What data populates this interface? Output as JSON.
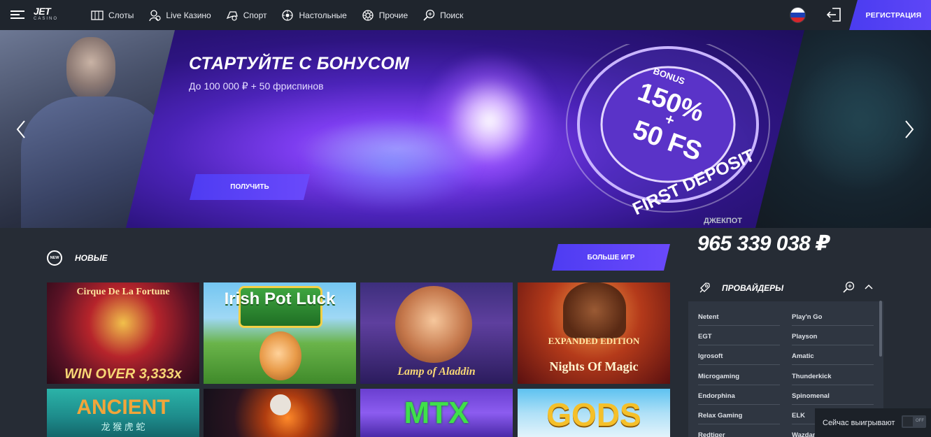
{
  "header": {
    "logo_main": "JET",
    "logo_sub": "CASINO",
    "nav": [
      {
        "label": "Слоты",
        "icon": "slots-icon"
      },
      {
        "label": "Live Казино",
        "icon": "live-casino-icon"
      },
      {
        "label": "Спорт",
        "icon": "sport-icon"
      },
      {
        "label": "Настольные",
        "icon": "table-games-icon"
      },
      {
        "label": "Прочие",
        "icon": "other-games-icon"
      },
      {
        "label": "Поиск",
        "icon": "search-icon"
      }
    ],
    "register_label": "РЕГИСТРАЦИЯ"
  },
  "banner": {
    "title": "СТАРТУЙТЕ С БОНУСОМ",
    "subtitle": "До 100 000 ₽ + 50 фриспинов",
    "button_label": "ПОЛУЧИТЬ",
    "coin_bonus": "BONUS",
    "coin_percent": "150%",
    "coin_plus": "+",
    "coin_fs": "50 FS",
    "coin_deposit": "FIRST DEPOSIT"
  },
  "jackpot": {
    "label": "ДЖЕКПОТ",
    "value": "965 339 038 ₽"
  },
  "new_games": {
    "badge": "NEW",
    "title": "НОВЫЕ",
    "more_label": "БОЛЬШЕ ИГР",
    "games": [
      {
        "title": "Cirque De La Fortune",
        "subtitle": "WIN OVER 3,333x"
      },
      {
        "title": "Irish Pot Luck",
        "subtitle": ""
      },
      {
        "title": "Lamp of Aladdin",
        "subtitle": ""
      },
      {
        "title": "EXPANDED EDITION",
        "subtitle": "Nights Of Magic"
      },
      {
        "title": "ANCIENT",
        "subtitle": "龙 猴 虎 蛇"
      },
      {
        "title": "",
        "subtitle": ""
      },
      {
        "title": "MTX",
        "subtitle": ""
      },
      {
        "title": "GODS",
        "subtitle": ""
      }
    ]
  },
  "providers": {
    "title": "ПРОВАЙДЕРЫ",
    "left": [
      "Netent",
      "EGT",
      "Igrosoft",
      "Microgaming",
      "Endorphina",
      "Relax Gaming",
      "Redtiger"
    ],
    "right": [
      "Play'n Go",
      "Playson",
      "Amatic",
      "Thunderkick",
      "Spinomenal",
      "ELK",
      "Wazdan"
    ]
  },
  "winning": {
    "label": "Сейчас выигрывают",
    "toggle": "OFF"
  },
  "colors": {
    "accent": "#5a44f6",
    "header_bg": "#1f252d",
    "page_bg": "#262c35"
  }
}
